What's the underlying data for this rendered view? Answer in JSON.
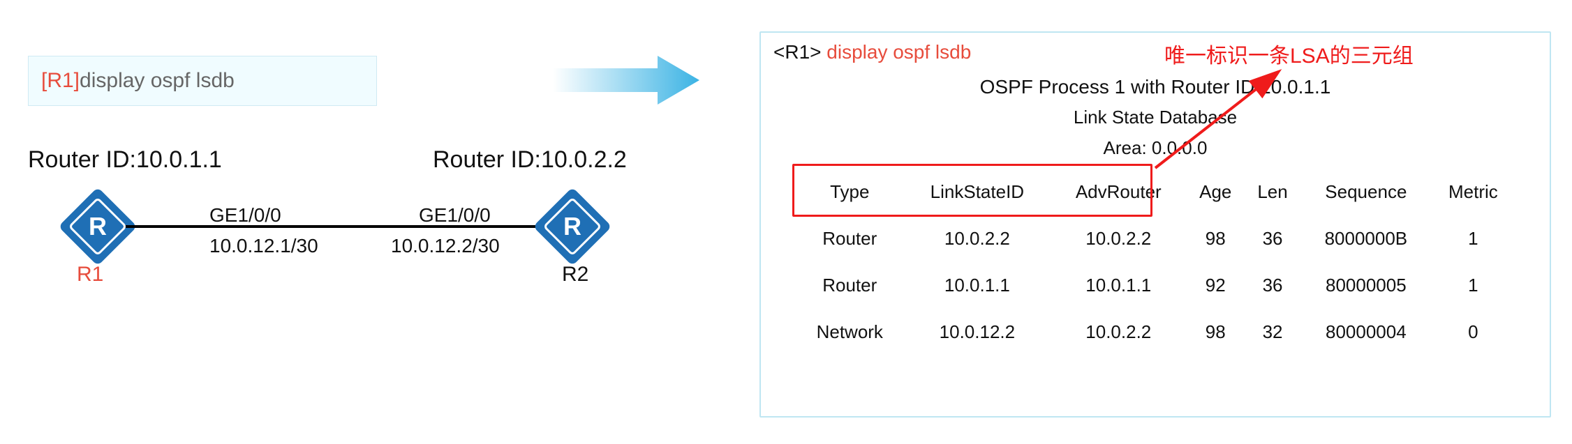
{
  "command_box": {
    "prompt": "[R1]",
    "cmd": "display ospf lsdb"
  },
  "left_router_id_label": "Router ID:10.0.1.1",
  "right_router_id_label": "Router ID:10.0.2.2",
  "topology": {
    "r1": {
      "label": "R1",
      "interface": "GE1/0/0",
      "ip": "10.0.12.1/30",
      "glyph": "R"
    },
    "r2": {
      "label": "R2",
      "interface": "GE1/0/0",
      "ip": "10.0.12.2/30",
      "glyph": "R"
    }
  },
  "panel": {
    "prompt": "<R1>",
    "cmd": " display ospf lsdb",
    "title1": "OSPF Process 1 with Router ID 10.0.1.1",
    "title2": "Link State Database",
    "area": "Area: 0.0.0.0",
    "headers": {
      "type": "Type",
      "ls": "LinkStateID",
      "adv": "AdvRouter",
      "age": "Age",
      "len": "Len",
      "seq": "Sequence",
      "metric": "Metric"
    },
    "rows": [
      {
        "type": "Router",
        "ls": "10.0.2.2",
        "adv": "10.0.2.2",
        "age": "98",
        "len": "36",
        "seq": "8000000B",
        "metric": "1"
      },
      {
        "type": "Router",
        "ls": "10.0.1.1",
        "adv": "10.0.1.1",
        "age": "92",
        "len": "36",
        "seq": "80000005",
        "metric": "1"
      },
      {
        "type": "Network",
        "ls": "10.0.12.2",
        "adv": "10.0.2.2",
        "age": "98",
        "len": "32",
        "seq": "80000004",
        "metric": "0"
      }
    ]
  },
  "callout": "唯一标识一条LSA的三元组"
}
